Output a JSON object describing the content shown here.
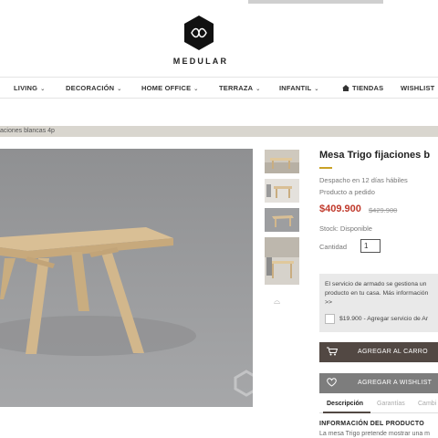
{
  "brand": {
    "name": "MEDULAR"
  },
  "nav": {
    "items": [
      {
        "label": "LIVING",
        "dropdown": true
      },
      {
        "label": "DECORACIÓN",
        "dropdown": true
      },
      {
        "label": "HOME OFFICE",
        "dropdown": true
      },
      {
        "label": "TERRAZA",
        "dropdown": true
      },
      {
        "label": "INFANTIL",
        "dropdown": true
      },
      {
        "label": "TIENDAS",
        "icon": "home-icon"
      },
      {
        "label": "WISHLIST"
      }
    ],
    "chevron": "⌄"
  },
  "breadcrumb": {
    "text": "aciones blancas 4p"
  },
  "product": {
    "title": "Mesa Trigo fijaciones b",
    "dispatch": "Despacho en 12 días hábiles",
    "on_demand": "Producto a pedido",
    "price": "$409.900",
    "price_old": "$429.900",
    "stock": "Stock: Disponible",
    "quantity_label": "Cantidad",
    "quantity_value": "1",
    "thumb_more": "⌓"
  },
  "assembly": {
    "note_line1": "El servicio de armado se gestiona un",
    "note_line2": "producto en tu casa. Más información",
    "note_line3": ">>",
    "option_label": "$19.900 - Agregar servicio de Ar"
  },
  "buttons": {
    "add_to_cart": "AGREGAR AL CARRO",
    "add_to_wishlist": "AGREGAR A WISHLIST"
  },
  "tabs": [
    {
      "label": "Descripción",
      "active": true
    },
    {
      "label": "Garantías",
      "active": false
    },
    {
      "label": "Cambi",
      "active": false
    }
  ],
  "info": {
    "title": "INFORMACIÓN DEL PRODUCTO",
    "text": "La mesa Trigo pretende mostrar una m"
  },
  "colors": {
    "accent": "#c9a227",
    "price": "#c0392b",
    "cart_button": "#524843",
    "wish_button": "#7d7d7d",
    "breadcrumb_bg": "#d9d6cf"
  }
}
